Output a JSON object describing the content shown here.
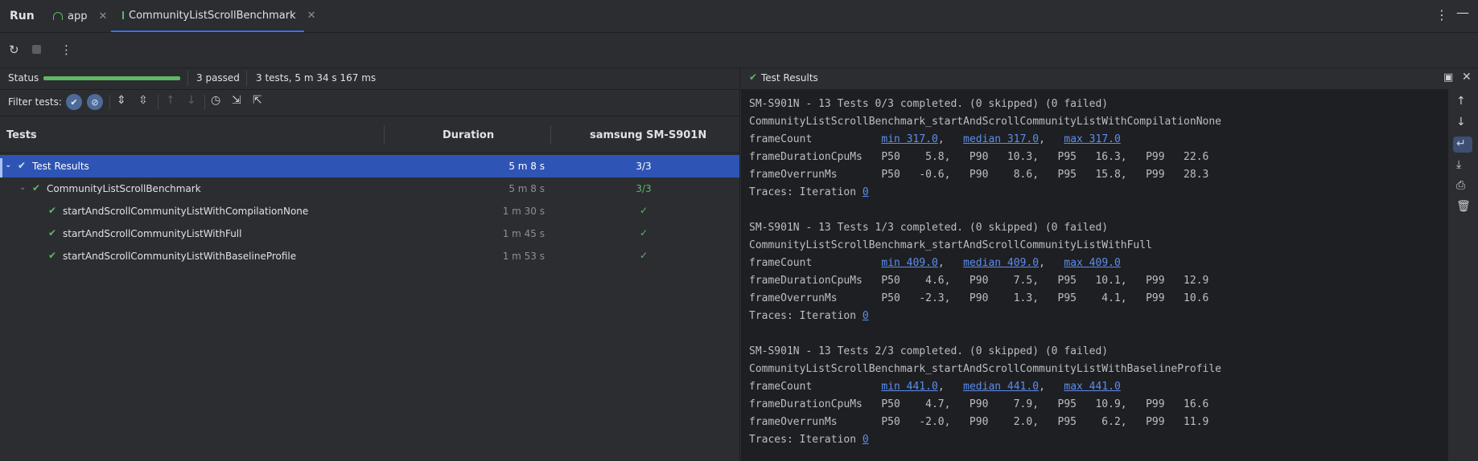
{
  "header": {
    "run_label": "Run",
    "tabs": [
      {
        "label": "app",
        "active": false
      },
      {
        "label": "CommunityListScrollBenchmark",
        "active": true
      }
    ]
  },
  "status": {
    "label": "Status",
    "progress": 1.0,
    "passed": "3 passed",
    "summary": "3 tests, 5 m 34 s 167 ms"
  },
  "filter": {
    "label": "Filter tests:"
  },
  "table": {
    "columns": [
      "Tests",
      "Duration",
      "samsung SM-S901N"
    ],
    "rows": [
      {
        "name": "Test Results",
        "duration": "5 m 8 s",
        "result": "3/3"
      },
      {
        "name": "CommunityListScrollBenchmark",
        "duration": "5 m 8 s",
        "result": "3/3"
      },
      {
        "name": "startAndScrollCommunityListWithCompilationNone",
        "duration": "1 m 30 s",
        "result": "✓"
      },
      {
        "name": "startAndScrollCommunityListWithFull",
        "duration": "1 m 45 s",
        "result": "✓"
      },
      {
        "name": "startAndScrollCommunityListWithBaselineProfile",
        "duration": "1 m 53 s",
        "result": "✓"
      }
    ]
  },
  "results": {
    "title": "Test Results",
    "blocks": [
      {
        "head": "SM-S901N - 13 Tests 0/3 completed. (0 skipped) (0 failed)",
        "test": "CommunityListScrollBenchmark_startAndScrollCommunityListWithCompilationNone",
        "fc_label": "frameCount           ",
        "min": "min 317.0",
        "median": "median 317.0",
        "max": "max 317.0",
        "cpu": "frameDurationCpuMs   P50    5.8,   P90   10.3,   P95   16.3,   P99   22.6",
        "overrun": "frameOverrunMs       P50   -0.6,   P90    8.6,   P95   15.8,   P99   28.3",
        "traces": "Traces: Iteration ",
        "iter": "0"
      },
      {
        "head": "SM-S901N - 13 Tests 1/3 completed. (0 skipped) (0 failed)",
        "test": "CommunityListScrollBenchmark_startAndScrollCommunityListWithFull",
        "fc_label": "frameCount           ",
        "min": "min 409.0",
        "median": "median 409.0",
        "max": "max 409.0",
        "cpu": "frameDurationCpuMs   P50    4.6,   P90    7.5,   P95   10.1,   P99   12.9",
        "overrun": "frameOverrunMs       P50   -2.3,   P90    1.3,   P95    4.1,   P99   10.6",
        "traces": "Traces: Iteration ",
        "iter": "0"
      },
      {
        "head": "SM-S901N - 13 Tests 2/3 completed. (0 skipped) (0 failed)",
        "test": "CommunityListScrollBenchmark_startAndScrollCommunityListWithBaselineProfile",
        "fc_label": "frameCount           ",
        "min": "min 441.0",
        "median": "median 441.0",
        "max": "max 441.0",
        "cpu": "frameDurationCpuMs   P50    4.7,   P90    7.9,   P95   10.9,   P99   16.6",
        "overrun": "frameOverrunMs       P50   -2.0,   P90    2.0,   P95    6.2,   P99   11.9",
        "traces": "Traces: Iteration ",
        "iter": "0"
      }
    ]
  },
  "icons": [
    "rerun-icon",
    "stop-icon",
    "more-icon",
    "check-icon",
    "close-icon",
    "minimize-icon",
    "scroll-up-icon",
    "scroll-down-icon",
    "soft-wrap-icon",
    "scroll-to-end-icon",
    "print-icon",
    "trash-icon"
  ],
  "colors": {
    "accent": "#3574f0",
    "pass": "#5fb865",
    "selection": "#2e55b5",
    "link": "#5c8ded"
  }
}
